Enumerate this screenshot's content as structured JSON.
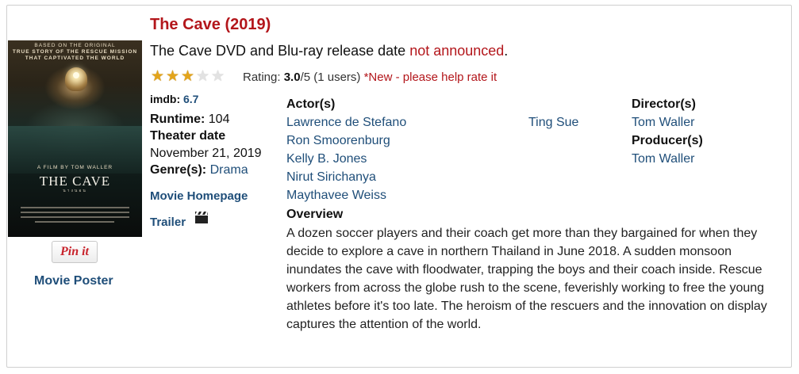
{
  "movie": {
    "title": "The Cave (2019)",
    "release_prefix": "The Cave DVD and Blu-ray release date",
    "release_status": "not announced",
    "release_suffix": "."
  },
  "rating": {
    "stars_filled": 3,
    "stars_total": 5,
    "label": "Rating:",
    "score": "3.0",
    "out_of": "/5 (1 users)",
    "note": "*New - please help rate it"
  },
  "details": {
    "imdb_label": "imdb:",
    "imdb_value": "6.7",
    "runtime_label": "Runtime:",
    "runtime_value": "104",
    "theater_label": "Theater date",
    "theater_value": "November 21, 2019",
    "genre_label": "Genre(s):",
    "genre_value": "Drama",
    "homepage_link": "Movie Homepage",
    "trailer_link": "Trailer"
  },
  "cast": {
    "heading": "Actor(s)",
    "actors_col1": [
      "Lawrence de Stefano",
      "Ron Smoorenburg",
      "Kelly B. Jones",
      "Nirut Sirichanya",
      "Maythavee Weiss"
    ],
    "actors_col2": [
      "Ting Sue"
    ]
  },
  "crew": {
    "director_heading": "Director(s)",
    "director": "Tom Waller",
    "producer_heading": "Producer(s)",
    "producer": "Tom Waller"
  },
  "overview": {
    "heading": "Overview",
    "text": "A dozen soccer players and their coach get more than they bargained for when they decide to explore a cave in northern Thailand in June 2018. A sudden monsoon inundates the cave with floodwater, trapping the boys and their coach inside. Rescue workers from across the globe rush to the scene, feverishly working to free the young athletes before it's too late. The heroism of the rescuers and the innovation on display captures the attention of the world."
  },
  "poster": {
    "tagline_top": "BASED ON THE ORIGINAL",
    "tagline_1": "TRUE STORY OF THE RESCUE MISSION",
    "tagline_2": "THAT CAPTIVATED THE WORLD",
    "film_by": "A FILM BY TOM WALLER",
    "title": "THE CAVE",
    "subtitle": "นางนอน",
    "pin_button": "Pin it",
    "label": "Movie Poster"
  },
  "icons": {
    "star": "star-icon",
    "trailer": "clapperboard-icon"
  },
  "colors": {
    "title_red": "#b3161b",
    "link_blue": "#1f4e79",
    "star_gold": "#e3a41b"
  }
}
